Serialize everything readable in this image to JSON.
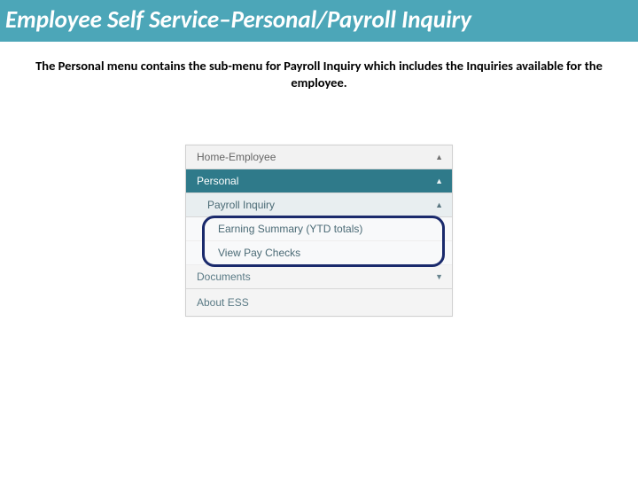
{
  "title": "Employee Self Service–Personal/Payroll Inquiry",
  "description": "The Personal menu contains the sub-menu for Payroll Inquiry which includes the Inquiries available for the employee.",
  "menu": {
    "home": "Home-Employee",
    "personal": "Personal",
    "payroll_inquiry": "Payroll Inquiry",
    "earning_summary": "Earning Summary (YTD totals)",
    "view_pay_checks": "View Pay Checks",
    "documents": "Documents",
    "about": "About ESS"
  }
}
